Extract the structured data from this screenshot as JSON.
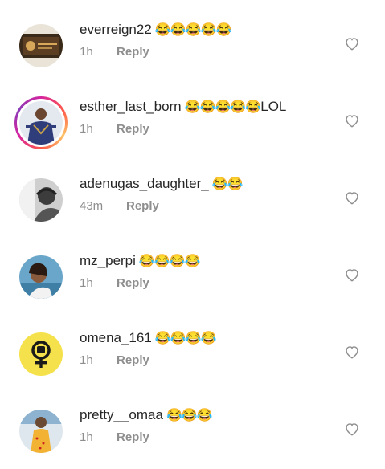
{
  "comments": [
    {
      "username": "everreign22",
      "emoji": "😂😂😂😂😂",
      "suffix": "",
      "time": "1h",
      "reply": "Reply"
    },
    {
      "username": "esther_last_born",
      "emoji": "😂😂😂😂😂",
      "suffix": "LOL",
      "time": "1h",
      "reply": "Reply"
    },
    {
      "username": "adenugas_daughter_",
      "emoji": "😂😂",
      "suffix": "",
      "time": "43m",
      "reply": "Reply"
    },
    {
      "username": "mz_perpi",
      "emoji": "😂😂😂😂",
      "suffix": "",
      "time": "1h",
      "reply": "Reply"
    },
    {
      "username": "omena_161",
      "emoji": "😂😂😂😂",
      "suffix": "",
      "time": "1h",
      "reply": "Reply"
    },
    {
      "username": "pretty__omaa",
      "emoji": "😂😂😂",
      "suffix": "",
      "time": "1h",
      "reply": "Reply"
    }
  ],
  "icons": {
    "like": "heart-outline-icon",
    "story_ring": "story-ring",
    "female_symbol": "female-fist-icon"
  },
  "colors": {
    "text": "#262626",
    "muted": "#8e8e8e",
    "yellow_avatar": "#f5e14b"
  }
}
